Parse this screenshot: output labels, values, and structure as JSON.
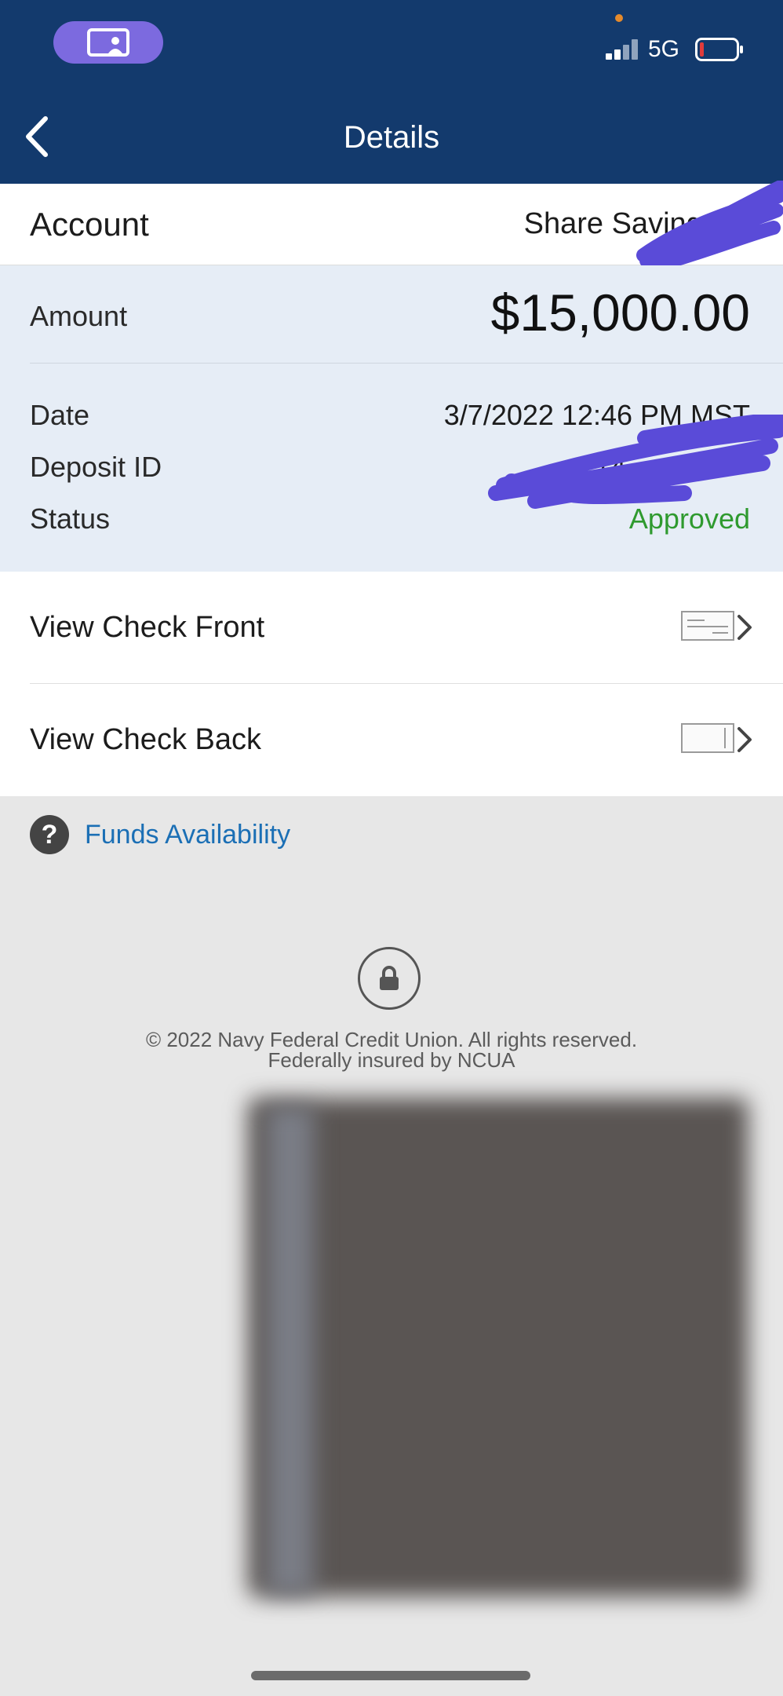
{
  "status_bar": {
    "network": "5G",
    "screen_share_icon": "screen-share-icon",
    "signal_icon": "signal-bars-icon",
    "battery_icon": "battery-low-icon"
  },
  "nav": {
    "title": "Details",
    "back_icon": "chevron-left-icon"
  },
  "account": {
    "label": "Account",
    "value": "Share Savings - "
  },
  "summary": {
    "amount_label": "Amount",
    "amount_value": "$15,000.00",
    "date_label": "Date",
    "date_value": "3/7/2022 12:46 PM MST",
    "deposit_id_label": "Deposit ID",
    "deposit_id_value": "14",
    "status_label": "Status",
    "status_value": "Approved"
  },
  "check_rows": [
    {
      "label": "View Check Front",
      "icon": "check-front-icon"
    },
    {
      "label": "View Check Back",
      "icon": "check-back-icon"
    }
  ],
  "funds": {
    "link_label": "Funds Availability",
    "icon": "help-icon",
    "icon_glyph": "?"
  },
  "footer": {
    "line1": "© 2022 Navy Federal Credit Union. All rights reserved.",
    "line2": "Federally insured by NCUA",
    "icon": "lock-icon"
  },
  "colors": {
    "header": "#133a6d",
    "panel": "#e6edf6",
    "approved": "#2f9a2f",
    "link": "#1b6fb5",
    "redaction": "#5a4bd8"
  }
}
